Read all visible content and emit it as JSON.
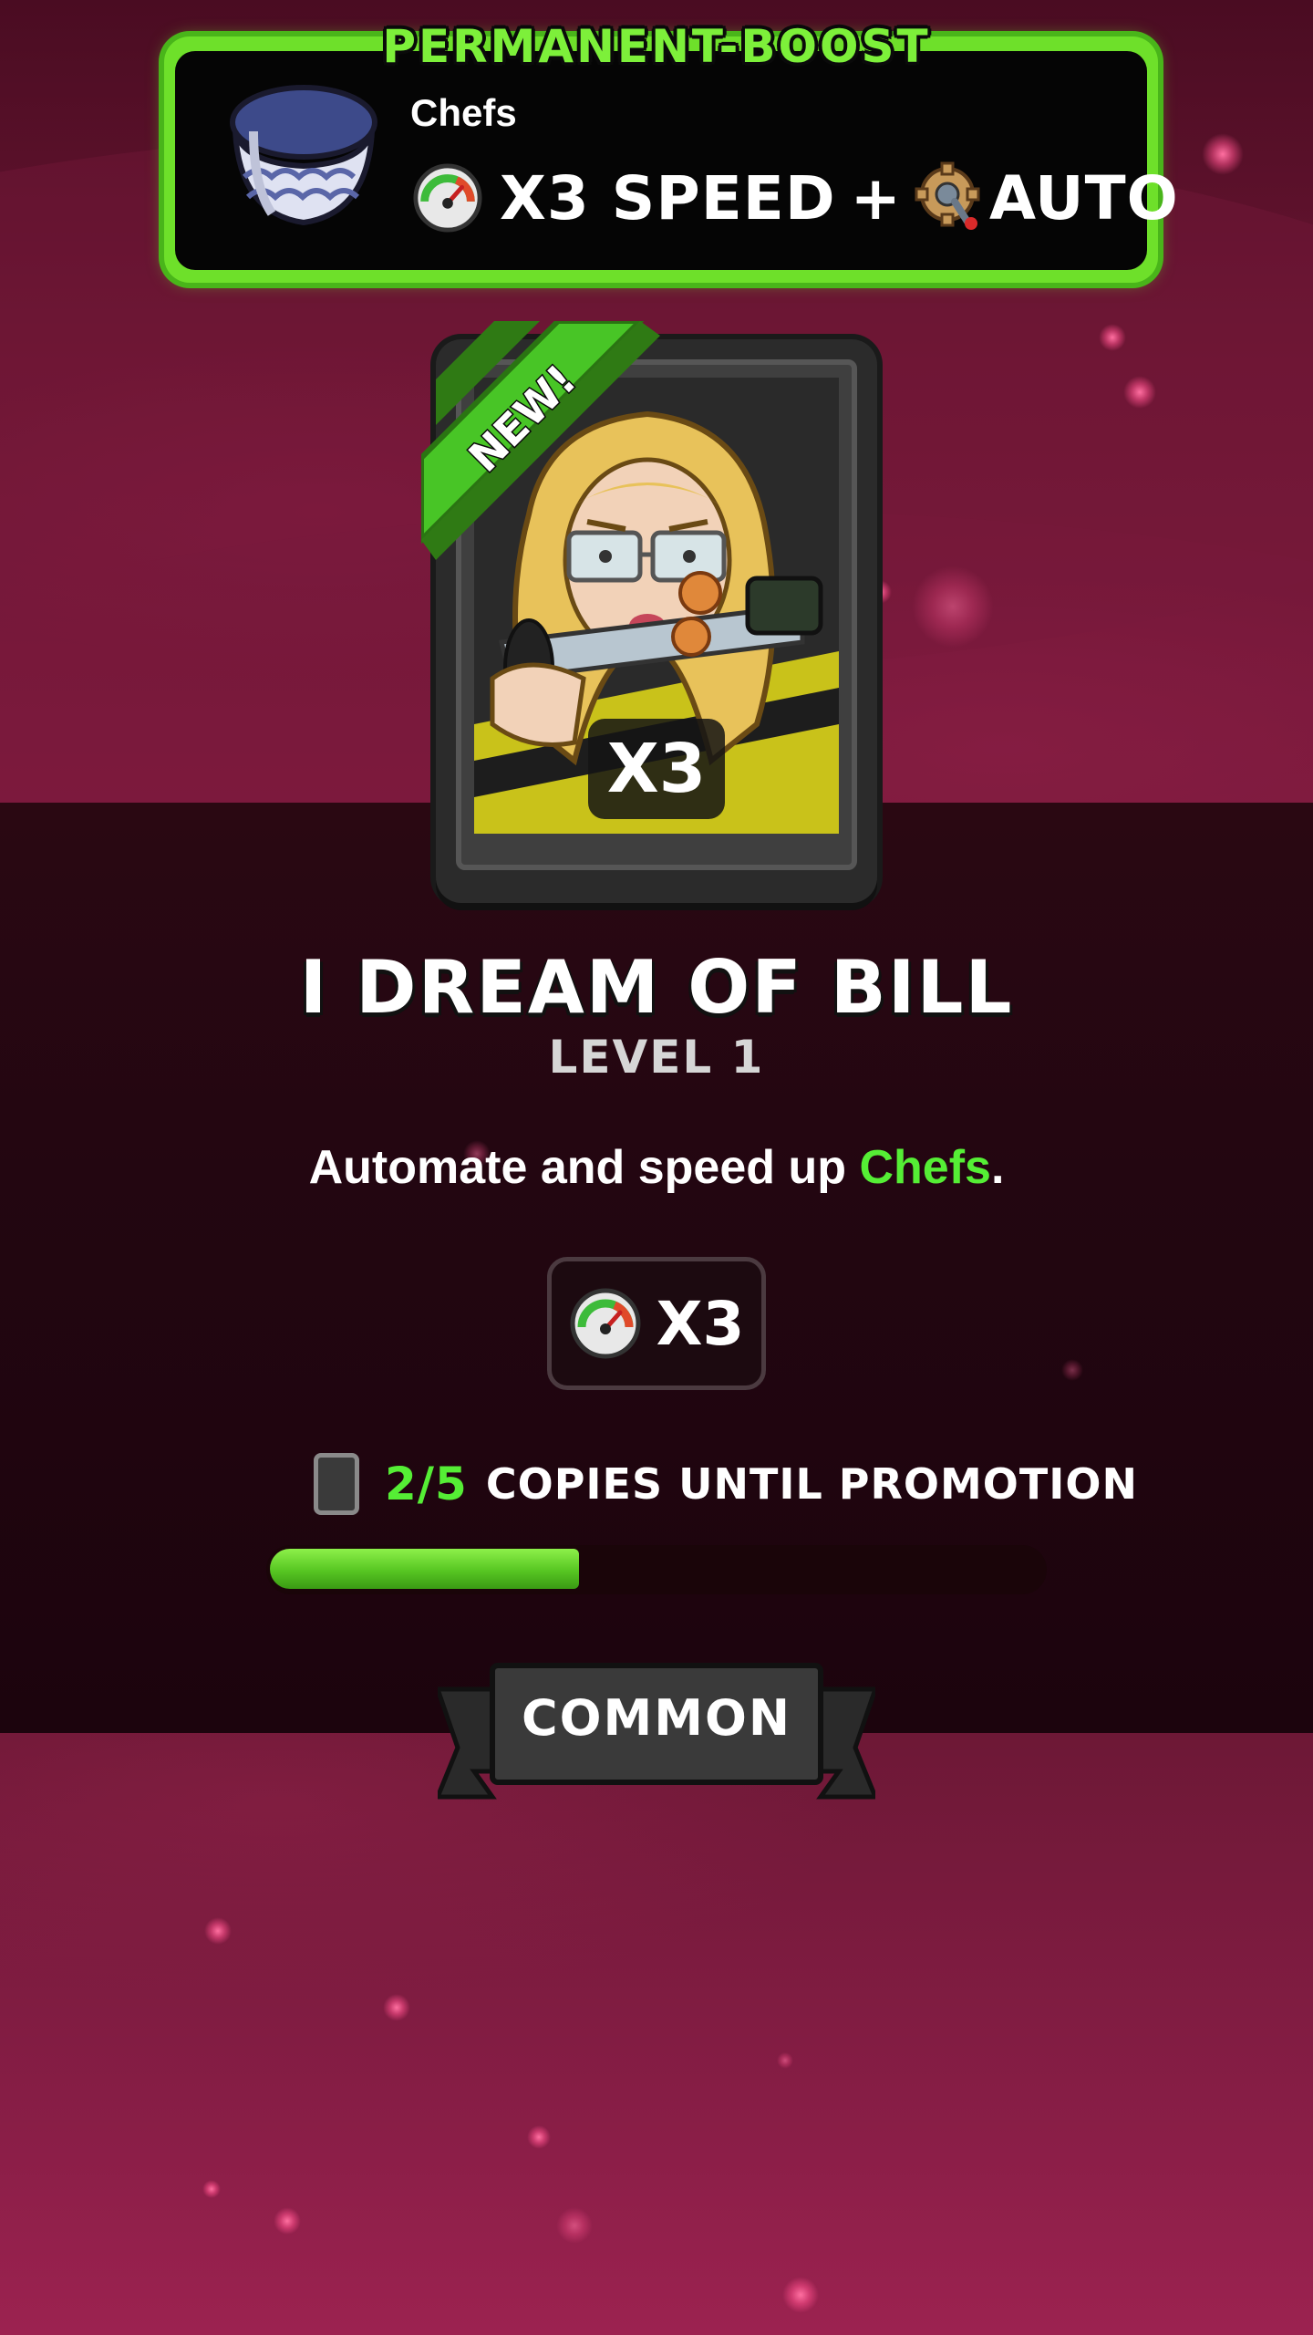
{
  "boost": {
    "title": "PERMANENT-BOOST",
    "label": "Chefs",
    "speed_text": "X3 SPEED",
    "plus": "+",
    "auto_text": "AUTO"
  },
  "card": {
    "badge": "NEW!",
    "multiplier": "X3",
    "name": "I DREAM OF BILL",
    "level": "LEVEL 1"
  },
  "description": {
    "prefix": "Automate and speed up ",
    "highlight": "Chefs",
    "suffix": "."
  },
  "stat": {
    "icon": "speed-gauge-icon",
    "value": "X3"
  },
  "copies": {
    "count": "2/5",
    "text": "COPIES UNTIL PROMOTION",
    "progress": 0.4
  },
  "rarity": {
    "label": "COMMON"
  },
  "colors": {
    "accent_green": "#55ee35",
    "boost_border": "#6ee02a",
    "background": "#6a1532"
  }
}
